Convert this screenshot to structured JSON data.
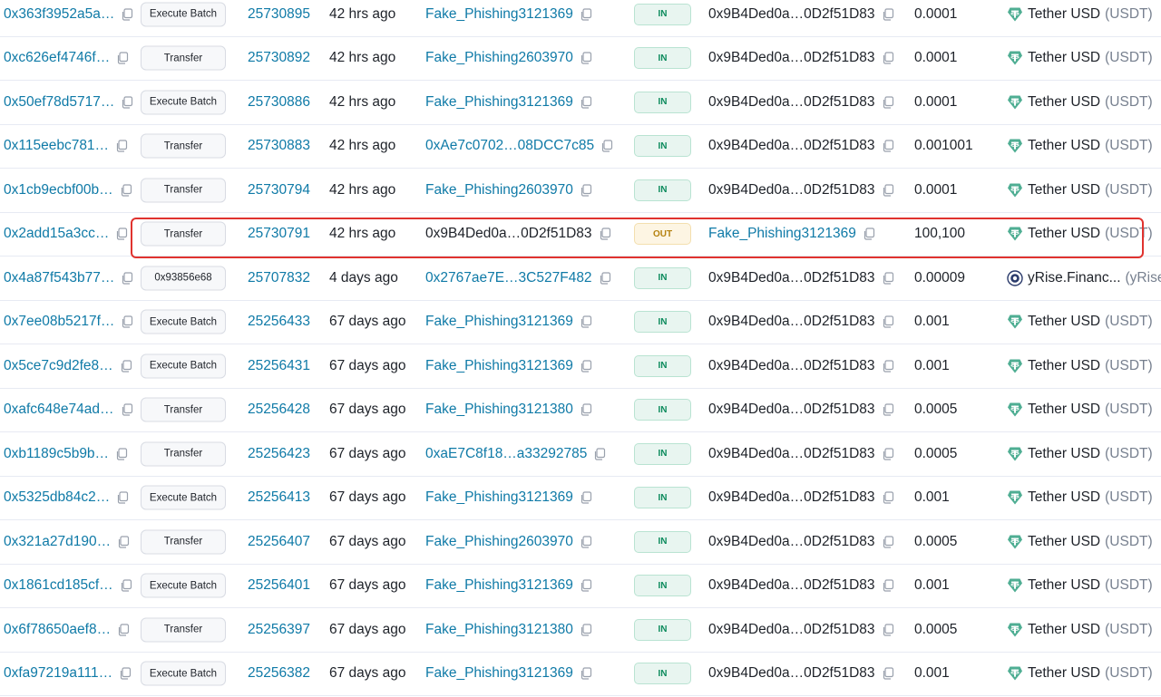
{
  "colors": {
    "link": "#0f7aa7",
    "in_badge": "#0b8a5c",
    "out_badge": "#b5820f",
    "highlight": "#e0332f",
    "tether": "#4fae93"
  },
  "rows": [
    {
      "hash": "0x363f3952a5a…",
      "method": "Execute Batch",
      "block": "25730895",
      "age": "42 hrs ago",
      "from": "Fake_Phishing3121369",
      "dir": "IN",
      "to": "0x9B4Ded0a…0D2f51D83",
      "amount": "0.0001",
      "token_name": "Tether USD",
      "token_symbol": "(USDT)",
      "token_icon": "tether-icon"
    },
    {
      "hash": "0xc626ef4746f…",
      "method": "Transfer",
      "block": "25730892",
      "age": "42 hrs ago",
      "from": "Fake_Phishing2603970",
      "dir": "IN",
      "to": "0x9B4Ded0a…0D2f51D83",
      "amount": "0.0001",
      "token_name": "Tether USD",
      "token_symbol": "(USDT)",
      "token_icon": "tether-icon"
    },
    {
      "hash": "0x50ef78d5717…",
      "method": "Execute Batch",
      "block": "25730886",
      "age": "42 hrs ago",
      "from": "Fake_Phishing3121369",
      "dir": "IN",
      "to": "0x9B4Ded0a…0D2f51D83",
      "amount": "0.0001",
      "token_name": "Tether USD",
      "token_symbol": "(USDT)",
      "token_icon": "tether-icon"
    },
    {
      "hash": "0x115eebc781…",
      "method": "Transfer",
      "block": "25730883",
      "age": "42 hrs ago",
      "from": "0xAe7c0702…08DCC7c85",
      "dir": "IN",
      "to": "0x9B4Ded0a…0D2f51D83",
      "amount": "0.001001",
      "token_name": "Tether USD",
      "token_symbol": "(USDT)",
      "token_icon": "tether-icon"
    },
    {
      "hash": "0x1cb9ecbf00b…",
      "method": "Transfer",
      "block": "25730794",
      "age": "42 hrs ago",
      "from": "Fake_Phishing2603970",
      "dir": "IN",
      "to": "0x9B4Ded0a…0D2f51D83",
      "amount": "0.0001",
      "token_name": "Tether USD",
      "token_symbol": "(USDT)",
      "token_icon": "tether-icon"
    },
    {
      "hash": "0x2add15a3cc…",
      "method": "Transfer",
      "block": "25730791",
      "age": "42 hrs ago",
      "from": "0x9B4Ded0a…0D2f51D83",
      "dir": "OUT",
      "to": "Fake_Phishing3121369",
      "amount": "100,100",
      "token_name": "Tether USD",
      "token_symbol": "(USDT)",
      "token_icon": "tether-icon",
      "highlighted": true
    },
    {
      "hash": "0x4a87f543b77…",
      "method": "0x93856e68",
      "block": "25707832",
      "age": "4 days ago",
      "from": "0x2767ae7E…3C527F482",
      "dir": "IN",
      "to": "0x9B4Ded0a…0D2f51D83",
      "amount": "0.00009",
      "token_name": "yRise.Financ...",
      "token_symbol": "(yRise)",
      "token_icon": "yrise-icon"
    },
    {
      "hash": "0x7ee08b5217f…",
      "method": "Execute Batch",
      "block": "25256433",
      "age": "67 days ago",
      "from": "Fake_Phishing3121369",
      "dir": "IN",
      "to": "0x9B4Ded0a…0D2f51D83",
      "amount": "0.001",
      "token_name": "Tether USD",
      "token_symbol": "(USDT)",
      "token_icon": "tether-icon"
    },
    {
      "hash": "0x5ce7c9d2fe8…",
      "method": "Execute Batch",
      "block": "25256431",
      "age": "67 days ago",
      "from": "Fake_Phishing3121369",
      "dir": "IN",
      "to": "0x9B4Ded0a…0D2f51D83",
      "amount": "0.001",
      "token_name": "Tether USD",
      "token_symbol": "(USDT)",
      "token_icon": "tether-icon"
    },
    {
      "hash": "0xafc648e74ad…",
      "method": "Transfer",
      "block": "25256428",
      "age": "67 days ago",
      "from": "Fake_Phishing3121380",
      "dir": "IN",
      "to": "0x9B4Ded0a…0D2f51D83",
      "amount": "0.0005",
      "token_name": "Tether USD",
      "token_symbol": "(USDT)",
      "token_icon": "tether-icon"
    },
    {
      "hash": "0xb1189c5b9b…",
      "method": "Transfer",
      "block": "25256423",
      "age": "67 days ago",
      "from": "0xaE7C8f18…a33292785",
      "dir": "IN",
      "to": "0x9B4Ded0a…0D2f51D83",
      "amount": "0.0005",
      "token_name": "Tether USD",
      "token_symbol": "(USDT)",
      "token_icon": "tether-icon"
    },
    {
      "hash": "0x5325db84c2…",
      "method": "Execute Batch",
      "block": "25256413",
      "age": "67 days ago",
      "from": "Fake_Phishing3121369",
      "dir": "IN",
      "to": "0x9B4Ded0a…0D2f51D83",
      "amount": "0.001",
      "token_name": "Tether USD",
      "token_symbol": "(USDT)",
      "token_icon": "tether-icon"
    },
    {
      "hash": "0x321a27d190…",
      "method": "Transfer",
      "block": "25256407",
      "age": "67 days ago",
      "from": "Fake_Phishing2603970",
      "dir": "IN",
      "to": "0x9B4Ded0a…0D2f51D83",
      "amount": "0.0005",
      "token_name": "Tether USD",
      "token_symbol": "(USDT)",
      "token_icon": "tether-icon"
    },
    {
      "hash": "0x1861cd185cf…",
      "method": "Execute Batch",
      "block": "25256401",
      "age": "67 days ago",
      "from": "Fake_Phishing3121369",
      "dir": "IN",
      "to": "0x9B4Ded0a…0D2f51D83",
      "amount": "0.001",
      "token_name": "Tether USD",
      "token_symbol": "(USDT)",
      "token_icon": "tether-icon"
    },
    {
      "hash": "0x6f78650aef8…",
      "method": "Transfer",
      "block": "25256397",
      "age": "67 days ago",
      "from": "Fake_Phishing3121380",
      "dir": "IN",
      "to": "0x9B4Ded0a…0D2f51D83",
      "amount": "0.0005",
      "token_name": "Tether USD",
      "token_symbol": "(USDT)",
      "token_icon": "tether-icon"
    },
    {
      "hash": "0xfa97219a111…",
      "method": "Execute Batch",
      "block": "25256382",
      "age": "67 days ago",
      "from": "Fake_Phishing3121369",
      "dir": "IN",
      "to": "0x9B4Ded0a…0D2f51D83",
      "amount": "0.001",
      "token_name": "Tether USD",
      "token_symbol": "(USDT)",
      "token_icon": "tether-icon"
    }
  ]
}
